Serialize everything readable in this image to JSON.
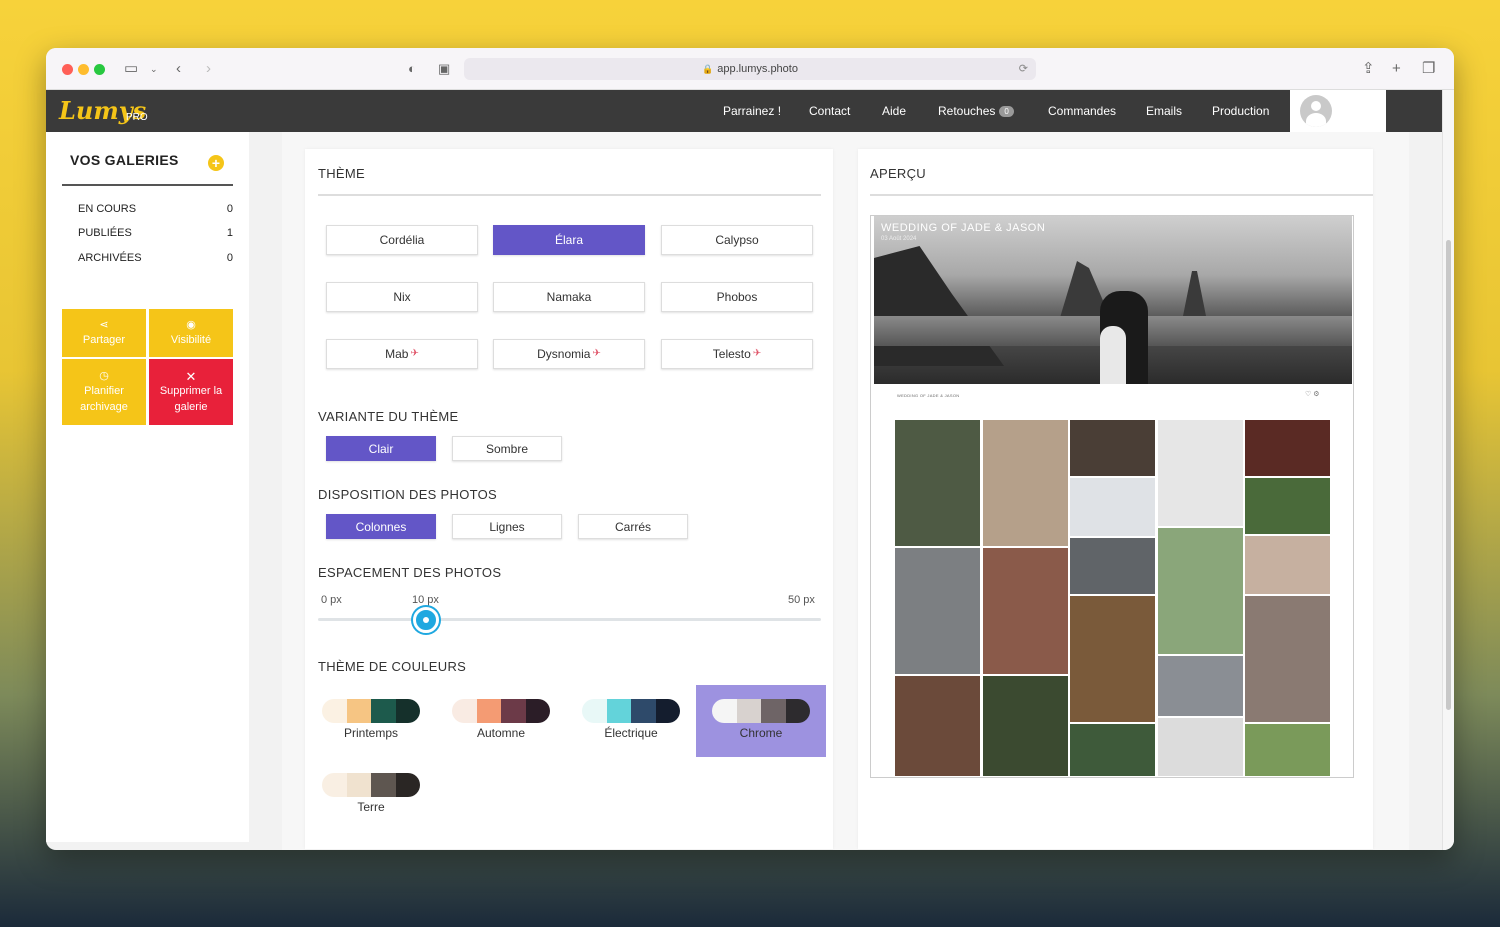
{
  "browser": {
    "url": "app.lumys.photo"
  },
  "appnav": {
    "logo": "Lumys",
    "logo_suffix": "PRO",
    "items": [
      {
        "label": "Parrainez !"
      },
      {
        "label": "Contact"
      },
      {
        "label": "Aide"
      },
      {
        "label": "Retouches",
        "badge": "0"
      },
      {
        "label": "Commandes"
      },
      {
        "label": "Emails"
      },
      {
        "label": "Production"
      }
    ]
  },
  "sidebar": {
    "title": "VOS GALERIES",
    "rows": [
      {
        "label": "EN COURS",
        "count": "0"
      },
      {
        "label": "PUBLIÉES",
        "count": "1"
      },
      {
        "label": "ARCHIVÉES",
        "count": "0"
      }
    ],
    "actions": [
      {
        "label": "Partager",
        "icon": "share-icon"
      },
      {
        "label": "Visibilité",
        "icon": "eye-icon"
      },
      {
        "label": "Planifier archivage",
        "icon": "clock-icon"
      },
      {
        "label": "Supprimer la galerie",
        "icon": "close-icon"
      }
    ]
  },
  "theme": {
    "title": "THÈME",
    "options": [
      {
        "label": "Cordélia",
        "selected": false,
        "premium": false
      },
      {
        "label": "Élara",
        "selected": true,
        "premium": false
      },
      {
        "label": "Calypso",
        "selected": false,
        "premium": false
      },
      {
        "label": "Nix",
        "selected": false,
        "premium": false
      },
      {
        "label": "Namaka",
        "selected": false,
        "premium": false
      },
      {
        "label": "Phobos",
        "selected": false,
        "premium": false
      },
      {
        "label": "Mab",
        "selected": false,
        "premium": true
      },
      {
        "label": "Dysnomia",
        "selected": false,
        "premium": true
      },
      {
        "label": "Telesto",
        "selected": false,
        "premium": true
      }
    ]
  },
  "variant": {
    "title": "VARIANTE DU THÈME",
    "options": [
      {
        "label": "Clair",
        "selected": true
      },
      {
        "label": "Sombre",
        "selected": false
      }
    ]
  },
  "layout": {
    "title": "DISPOSITION DES PHOTOS",
    "options": [
      {
        "label": "Colonnes",
        "selected": true
      },
      {
        "label": "Lignes",
        "selected": false
      },
      {
        "label": "Carrés",
        "selected": false
      }
    ]
  },
  "spacing": {
    "title": "ESPACEMENT DES PHOTOS",
    "min_label": "0 px",
    "value_label": "10 px",
    "max_label": "50 px",
    "value": 10,
    "min": 0,
    "max": 50
  },
  "colors": {
    "title": "THÈME DE COULEURS",
    "palettes": [
      {
        "label": "Printemps",
        "colors": [
          "#fbf1e3",
          "#f6c583",
          "#1d5a4c",
          "#15302b"
        ],
        "selected": false
      },
      {
        "label": "Automne",
        "colors": [
          "#f9ebe3",
          "#f49b73",
          "#6c3a48",
          "#2b1d27"
        ],
        "selected": false
      },
      {
        "label": "Électrique",
        "colors": [
          "#e8f8f7",
          "#63d3da",
          "#2e4a6a",
          "#141d2e"
        ],
        "selected": false
      },
      {
        "label": "Chrome",
        "colors": [
          "#f5f5f5",
          "#d8d2cf",
          "#6e6466",
          "#2d2b2e"
        ],
        "selected": true
      },
      {
        "label": "Terre",
        "colors": [
          "#f9efe3",
          "#f0e2cf",
          "#5e5650",
          "#2a2624"
        ],
        "selected": false
      }
    ]
  },
  "preview": {
    "title": "APERÇU",
    "hero_title": "WEDDING OF JADE & JASON",
    "hero_date": "03 Août 2024",
    "caption": "WEDDING OF JADE & JASON"
  }
}
